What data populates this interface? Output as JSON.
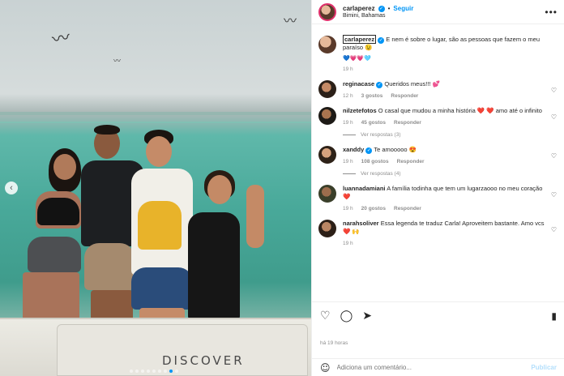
{
  "post": {
    "username": "carlaperez",
    "follow_label": "Seguir",
    "location": "Bimini, Bahamas",
    "boat_text": "DISCOVER",
    "carousel_prev": "‹",
    "more_glyph": "•••"
  },
  "caption": {
    "username": "carlaperez",
    "text": "E nem é sobre o lugar, são as pessoas que fazem o meu paraíso 😉",
    "emojis": "💙💗💗🩵",
    "time": "19 h"
  },
  "comments": [
    {
      "username": "reginacase",
      "verified": true,
      "text": "Queridos meus!!! 💕",
      "time": "12 h",
      "likes": "3 gostos",
      "reply": "Responder",
      "view_replies": ""
    },
    {
      "username": "nilzetefotos",
      "verified": false,
      "text": "O casal que mudou a minha história ❤️ ❤️ amo até o infinito",
      "time": "19 h",
      "likes": "45 gostos",
      "reply": "Responder",
      "view_replies": "Ver respostas (3)"
    },
    {
      "username": "xanddy",
      "verified": true,
      "text": "Te amooooo 😍",
      "time": "19 h",
      "likes": "108 gostos",
      "reply": "Responder",
      "view_replies": "Ver respostas (4)"
    },
    {
      "username": "luannadamiani",
      "verified": false,
      "text": "A família todinha que tem um lugarzaooo no meu coração ❤️",
      "time": "19 h",
      "likes": "20 gostos",
      "reply": "Responder",
      "view_replies": ""
    },
    {
      "username": "narahsoliver",
      "verified": false,
      "text": "Essa legenda te traduz Carla! Aproveitem bastante. Amo vcs ❤️ 🙌",
      "time": "19 h",
      "likes": "",
      "reply": "",
      "view_replies": ""
    }
  ],
  "footer": {
    "time_ago": "há 19 horas",
    "comment_placeholder": "Adiciona um comentário...",
    "publish_label": "Publicar"
  },
  "icons": {
    "heart": "♡",
    "comment": "◯",
    "share": "➤",
    "save": "▮",
    "smile": "☺",
    "bird": "⌒"
  }
}
